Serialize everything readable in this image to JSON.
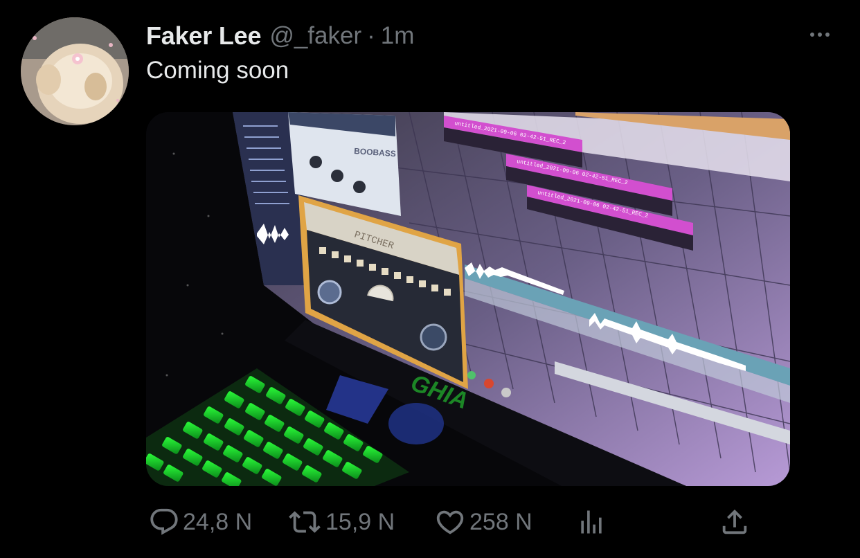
{
  "user": {
    "display_name": "Faker Lee",
    "handle": "@_faker",
    "separator": "·",
    "timestamp": "1m"
  },
  "tweet": {
    "text": "Coming soon"
  },
  "actions": {
    "reply_count": "24,8 N",
    "retweet_count": "15,9 N",
    "like_count": "258 N"
  },
  "icons": {
    "reply": "reply-icon",
    "retweet": "retweet-icon",
    "like": "heart-icon",
    "analytics": "analytics-icon",
    "share": "share-icon",
    "more": "more-icon"
  },
  "media": {
    "plugin_1": "BOOBASS",
    "plugin_2": "PITCHER",
    "clip_labels": [
      "untitled_2021-09-06 02-42-51_REC_2",
      "untitled_2021-09-06 02-42-51_REC_2",
      "untitled_2021-09-06 02-42-51_REC_2"
    ],
    "monitor_brand": "GHIA"
  },
  "colors": {
    "background": "#000000",
    "primary_text": "#e7e9ea",
    "secondary_text": "#71767b"
  }
}
